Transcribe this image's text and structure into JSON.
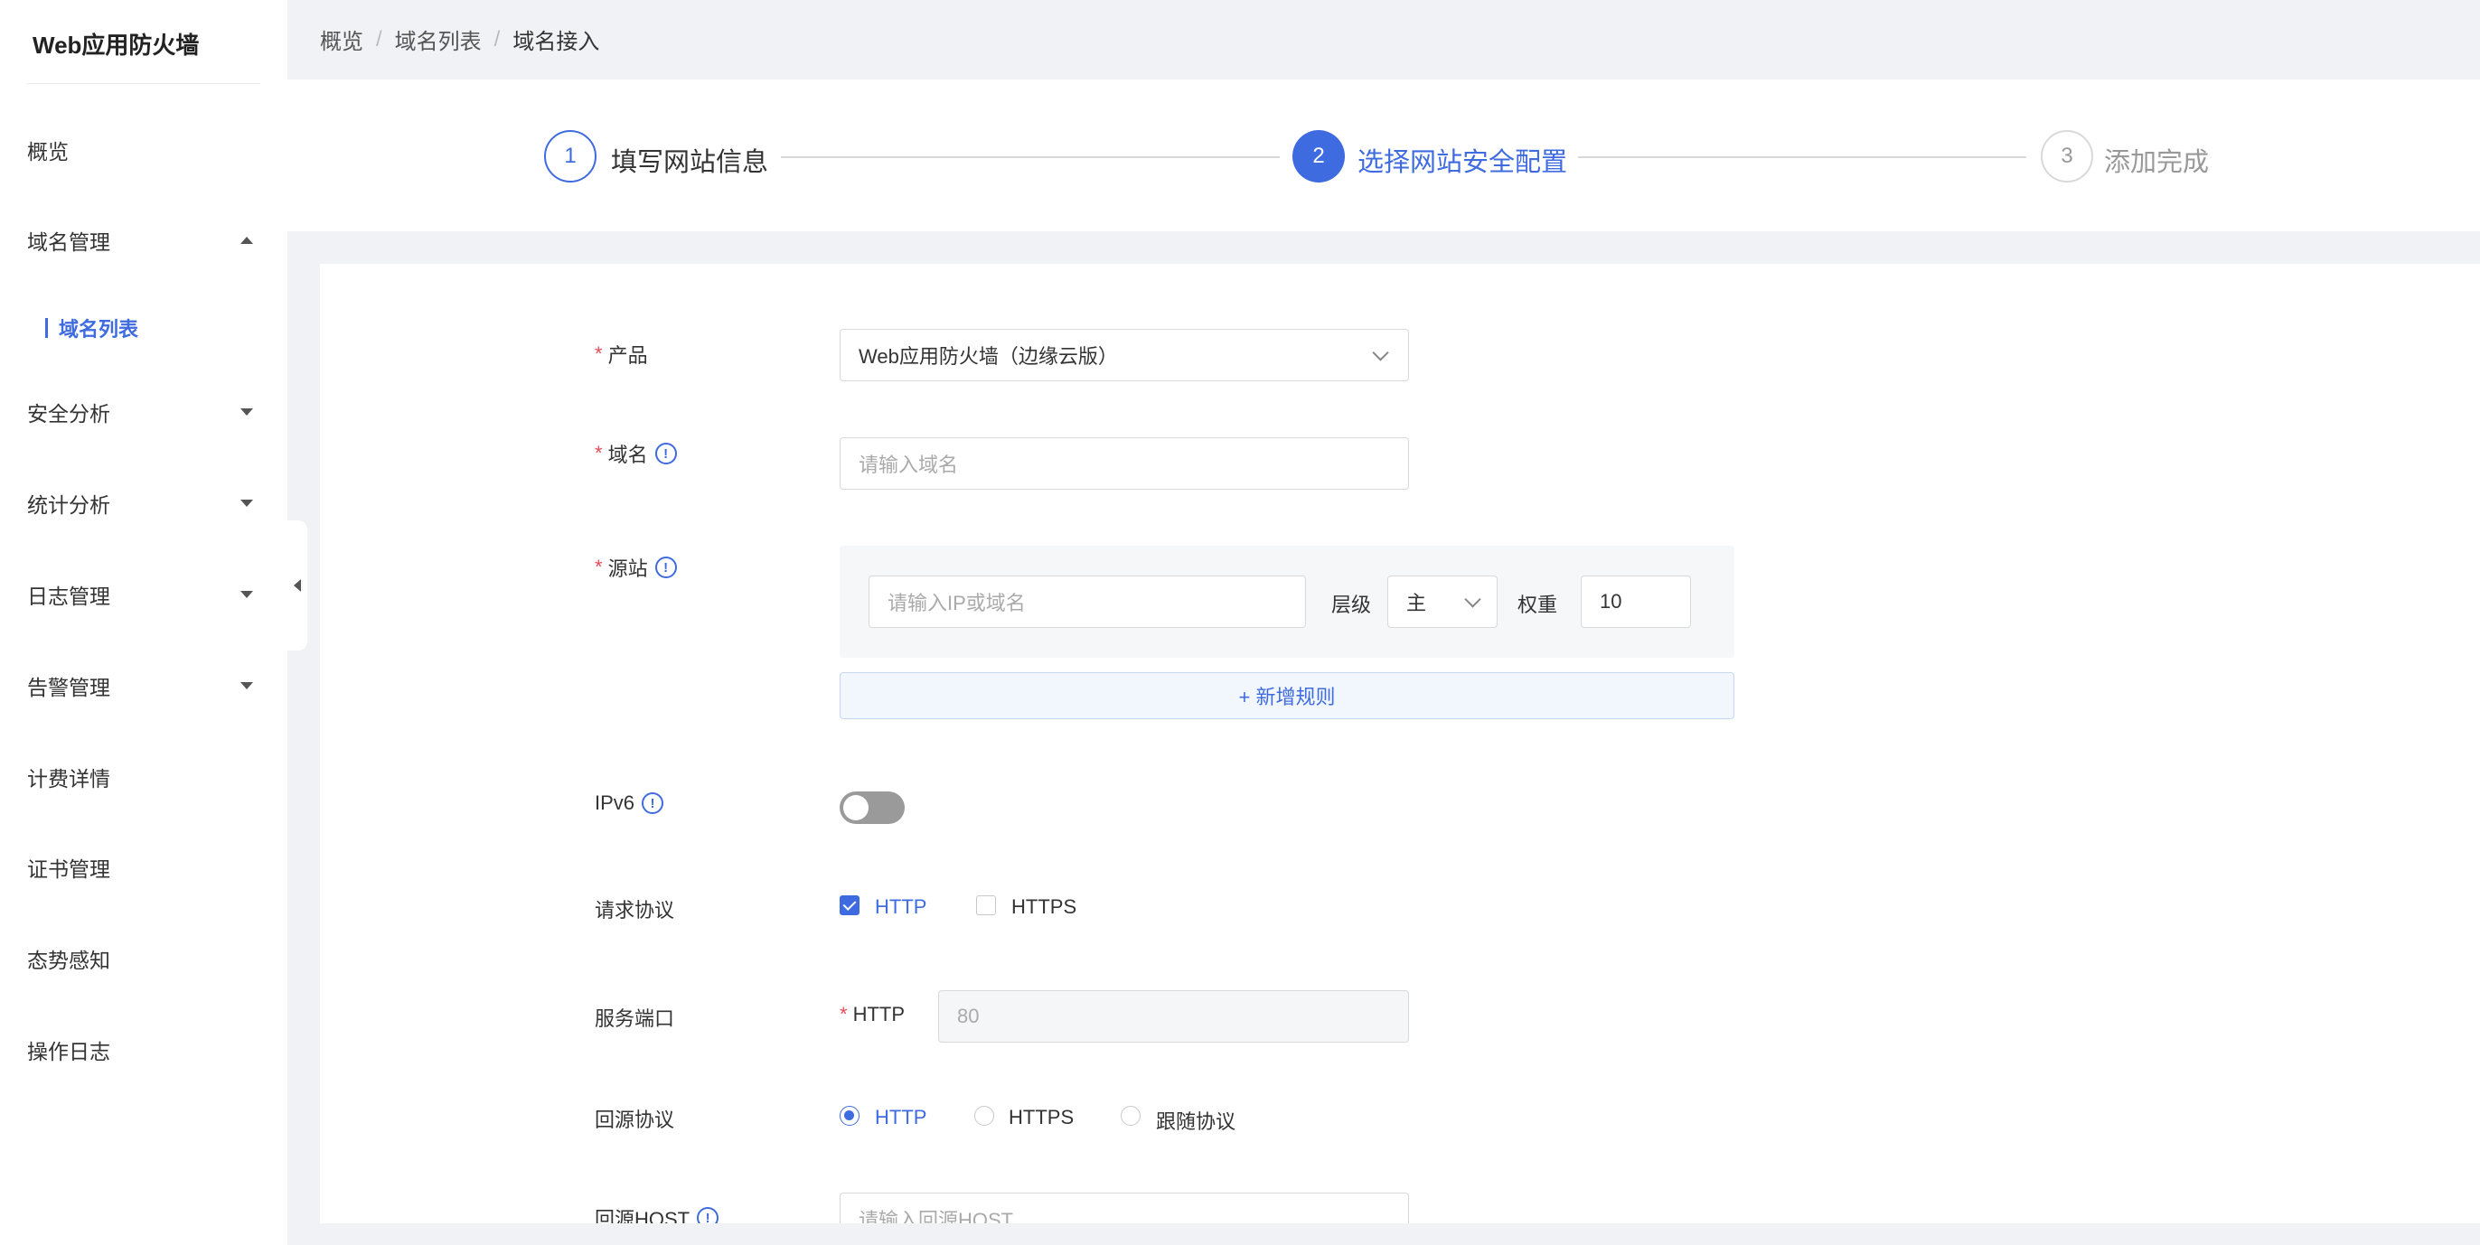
{
  "app": {
    "title": "Web应用防火墙"
  },
  "sidebar": {
    "items": [
      {
        "label": "概览"
      },
      {
        "label": "域名管理",
        "sub": [
          {
            "label": "域名列表"
          }
        ]
      },
      {
        "label": "安全分析"
      },
      {
        "label": "统计分析"
      },
      {
        "label": "日志管理"
      },
      {
        "label": "告警管理"
      },
      {
        "label": "计费详情"
      },
      {
        "label": "证书管理"
      },
      {
        "label": "态势感知"
      },
      {
        "label": "操作日志"
      }
    ]
  },
  "breadcrumb": {
    "items": [
      "概览",
      "域名列表",
      "域名接入"
    ],
    "separator": "/"
  },
  "steps": [
    {
      "number": "1",
      "label": "填写网站信息"
    },
    {
      "number": "2",
      "label": "选择网站安全配置"
    },
    {
      "number": "3",
      "label": "添加完成"
    }
  ],
  "form": {
    "product": {
      "label": "产品",
      "value": "Web应用防火墙（边缘云版）"
    },
    "domain": {
      "label": "域名",
      "placeholder": "请输入域名"
    },
    "origin": {
      "label": "源站",
      "ip_placeholder": "请输入IP或域名",
      "level_label": "层级",
      "level_value": "主",
      "weight_label": "权重",
      "weight_value": "10",
      "add_rule": "+ 新增规则"
    },
    "ipv6": {
      "label": "IPv6"
    },
    "request_protocol": {
      "label": "请求协议",
      "options": [
        "HTTP",
        "HTTPS"
      ]
    },
    "service_port": {
      "label": "服务端口",
      "protocol": "HTTP",
      "value": "80"
    },
    "origin_protocol": {
      "label": "回源协议",
      "options": [
        "HTTP",
        "HTTPS",
        "跟随协议"
      ]
    },
    "origin_host": {
      "label": "回源HOST",
      "placeholder": "请输入回源HOST"
    }
  },
  "icons": {
    "info": "!",
    "caret_down": "caret-down-icon",
    "caret_up": "caret-up-icon"
  },
  "colors": {
    "accent": "#3f6be0",
    "required": "#e34d59"
  }
}
